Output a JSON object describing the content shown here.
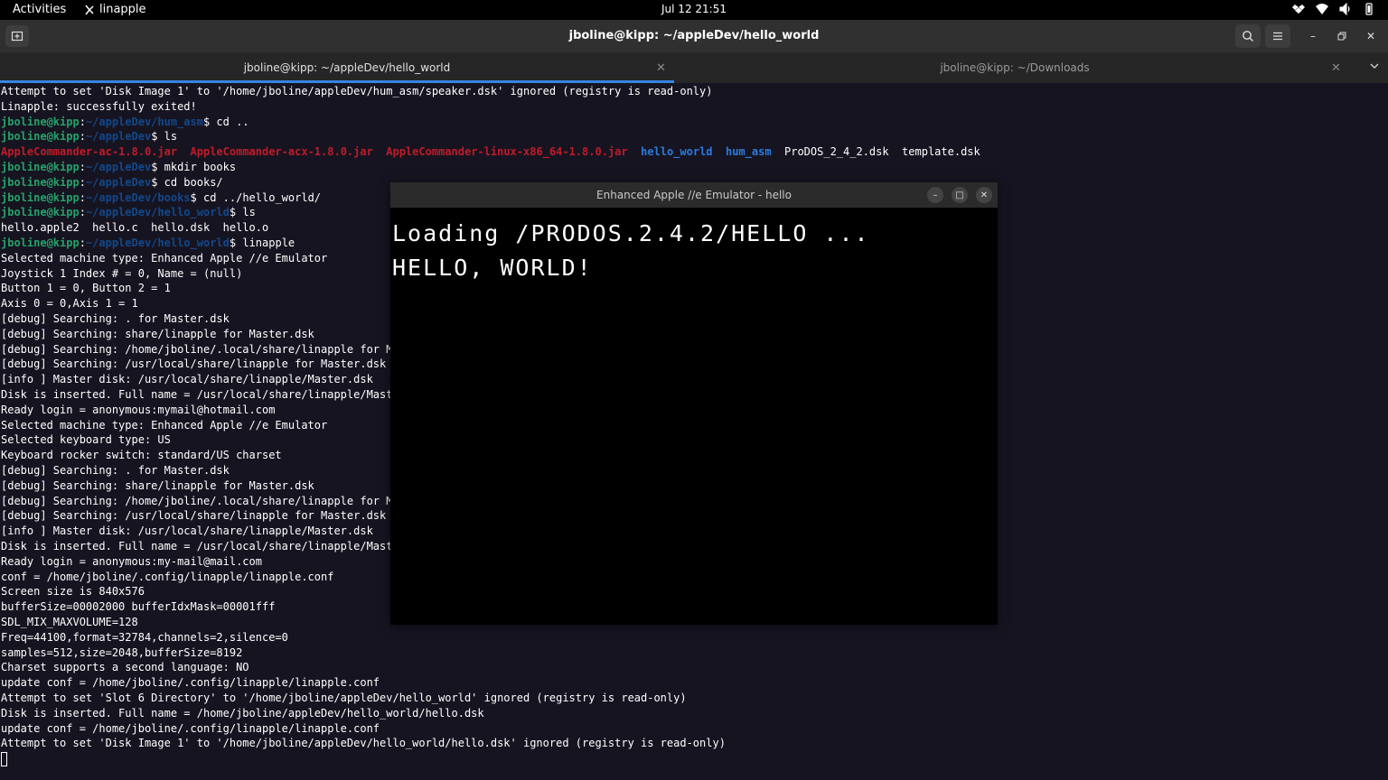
{
  "topbar": {
    "activities": "Activities",
    "app_name": "linapple",
    "clock": "Jul 12  21:51",
    "tray_icons": [
      "dropbox-icon",
      "wifi-icon",
      "volume-icon",
      "battery-icon"
    ]
  },
  "headerbar": {
    "title": "jboline@kipp: ~/appleDev/hello_world"
  },
  "tabs": [
    {
      "label": "jboline@kipp: ~/appleDev/hello_world",
      "active": true
    },
    {
      "label": "jboline@kipp: ~/Downloads",
      "active": false
    }
  ],
  "terminal": {
    "lines": [
      [
        {
          "t": "Attempt to set 'Disk Image 1' to '/home/jboline/appleDev/hum_asm/speaker.dsk' ignored (registry is read-only)"
        }
      ],
      [
        {
          "t": "Linapple: successfully exited!"
        }
      ],
      [
        {
          "t": "jboline@kipp",
          "c": "user"
        },
        {
          "t": ":"
        },
        {
          "t": "~/appleDev/hum_asm",
          "c": "path"
        },
        {
          "t": "$ cd .."
        }
      ],
      [
        {
          "t": "jboline@kipp",
          "c": "user"
        },
        {
          "t": ":"
        },
        {
          "t": "~/appleDev",
          "c": "path"
        },
        {
          "t": "$ ls"
        }
      ],
      [
        {
          "t": "AppleCommander-ac-1.8.0.jar",
          "c": "red"
        },
        {
          "t": "  "
        },
        {
          "t": "AppleCommander-acx-1.8.0.jar",
          "c": "red"
        },
        {
          "t": "  "
        },
        {
          "t": "AppleCommander-linux-x86_64-1.8.0.jar",
          "c": "red"
        },
        {
          "t": "  "
        },
        {
          "t": "hello_world",
          "c": "blue"
        },
        {
          "t": "  "
        },
        {
          "t": "hum_asm",
          "c": "blue"
        },
        {
          "t": "  ProDOS_2_4_2.dsk  template.dsk"
        }
      ],
      [
        {
          "t": "jboline@kipp",
          "c": "user"
        },
        {
          "t": ":"
        },
        {
          "t": "~/appleDev",
          "c": "path"
        },
        {
          "t": "$ mkdir books"
        }
      ],
      [
        {
          "t": "jboline@kipp",
          "c": "user"
        },
        {
          "t": ":"
        },
        {
          "t": "~/appleDev",
          "c": "path"
        },
        {
          "t": "$ cd books/"
        }
      ],
      [
        {
          "t": "jboline@kipp",
          "c": "user"
        },
        {
          "t": ":"
        },
        {
          "t": "~/appleDev/books",
          "c": "path"
        },
        {
          "t": "$ cd ../hello_world/"
        }
      ],
      [
        {
          "t": "jboline@kipp",
          "c": "user"
        },
        {
          "t": ":"
        },
        {
          "t": "~/appleDev/hello_world",
          "c": "path"
        },
        {
          "t": "$ ls"
        }
      ],
      [
        {
          "t": "hello.apple2  hello.c  hello.dsk  hello.o"
        }
      ],
      [
        {
          "t": "jboline@kipp",
          "c": "user"
        },
        {
          "t": ":"
        },
        {
          "t": "~/appleDev/hello_world",
          "c": "path"
        },
        {
          "t": "$ linapple"
        }
      ],
      [
        {
          "t": "Selected machine type: Enhanced Apple //e Emulator"
        }
      ],
      [
        {
          "t": "Joystick 1 Index # = 0, Name = (null)"
        }
      ],
      [
        {
          "t": "Button 1 = 0, Button 2 = 1"
        }
      ],
      [
        {
          "t": "Axis 0 = 0,Axis 1 = 1"
        }
      ],
      [
        {
          "t": "[debug] Searching: . for Master.dsk"
        }
      ],
      [
        {
          "t": "[debug] Searching: share/linapple for Master.dsk"
        }
      ],
      [
        {
          "t": "[debug] Searching: /home/jboline/.local/share/linapple for M"
        }
      ],
      [
        {
          "t": "[debug] Searching: /usr/local/share/linapple for Master.dsk"
        }
      ],
      [
        {
          "t": "[info ] Master disk: /usr/local/share/linapple/Master.dsk"
        }
      ],
      [
        {
          "t": "Disk is inserted. Full name = /usr/local/share/linapple/Mast"
        }
      ],
      [
        {
          "t": "Ready login = anonymous:mymail@hotmail.com"
        }
      ],
      [
        {
          "t": "Selected machine type: Enhanced Apple //e Emulator"
        }
      ],
      [
        {
          "t": "Selected keyboard type: US"
        }
      ],
      [
        {
          "t": "Keyboard rocker switch: standard/US charset"
        }
      ],
      [
        {
          "t": "[debug] Searching: . for Master.dsk"
        }
      ],
      [
        {
          "t": "[debug] Searching: share/linapple for Master.dsk"
        }
      ],
      [
        {
          "t": "[debug] Searching: /home/jboline/.local/share/linapple for M"
        }
      ],
      [
        {
          "t": "[debug] Searching: /usr/local/share/linapple for Master.dsk"
        }
      ],
      [
        {
          "t": "[info ] Master disk: /usr/local/share/linapple/Master.dsk"
        }
      ],
      [
        {
          "t": "Disk is inserted. Full name = /usr/local/share/linapple/Mast"
        }
      ],
      [
        {
          "t": "Ready login = anonymous:my-mail@mail.com"
        }
      ],
      [
        {
          "t": "conf = /home/jboline/.config/linapple/linapple.conf"
        }
      ],
      [
        {
          "t": "Screen size is 840x576"
        }
      ],
      [
        {
          "t": "bufferSize=00002000 bufferIdxMask=00001fff"
        }
      ],
      [
        {
          "t": "SDL_MIX_MAXVOLUME=128"
        }
      ],
      [
        {
          "t": "Freq=44100,format=32784,channels=2,silence=0"
        }
      ],
      [
        {
          "t": "samples=512,size=2048,bufferSize=8192"
        }
      ],
      [
        {
          "t": "Charset supports a second language: NO"
        }
      ],
      [
        {
          "t": "update conf = /home/jboline/.config/linapple/linapple.conf"
        }
      ],
      [
        {
          "t": "Attempt to set 'Slot 6 Directory' to '/home/jboline/appleDev/hello_world' ignored (registry is read-only)"
        }
      ],
      [
        {
          "t": "Disk is inserted. Full name = /home/jboline/appleDev/hello_world/hello.dsk"
        }
      ],
      [
        {
          "t": "update conf = /home/jboline/.config/linapple/linapple.conf"
        }
      ],
      [
        {
          "t": "Attempt to set 'Disk Image 1' to '/home/jboline/appleDev/hello_world/hello.dsk' ignored (registry is read-only)"
        }
      ]
    ]
  },
  "emulator": {
    "title": "Enhanced Apple //e Emulator - hello",
    "screen_lines": [
      "Loading /PRODOS.2.4.2/HELLO ...",
      "HELLO, WORLD!"
    ]
  },
  "colors": {
    "terminal_bg": "#171421",
    "user": "#26a269",
    "path": "#12488b",
    "red": "#c01c28",
    "blue": "#2a7bde",
    "accent": "#3584e4"
  }
}
